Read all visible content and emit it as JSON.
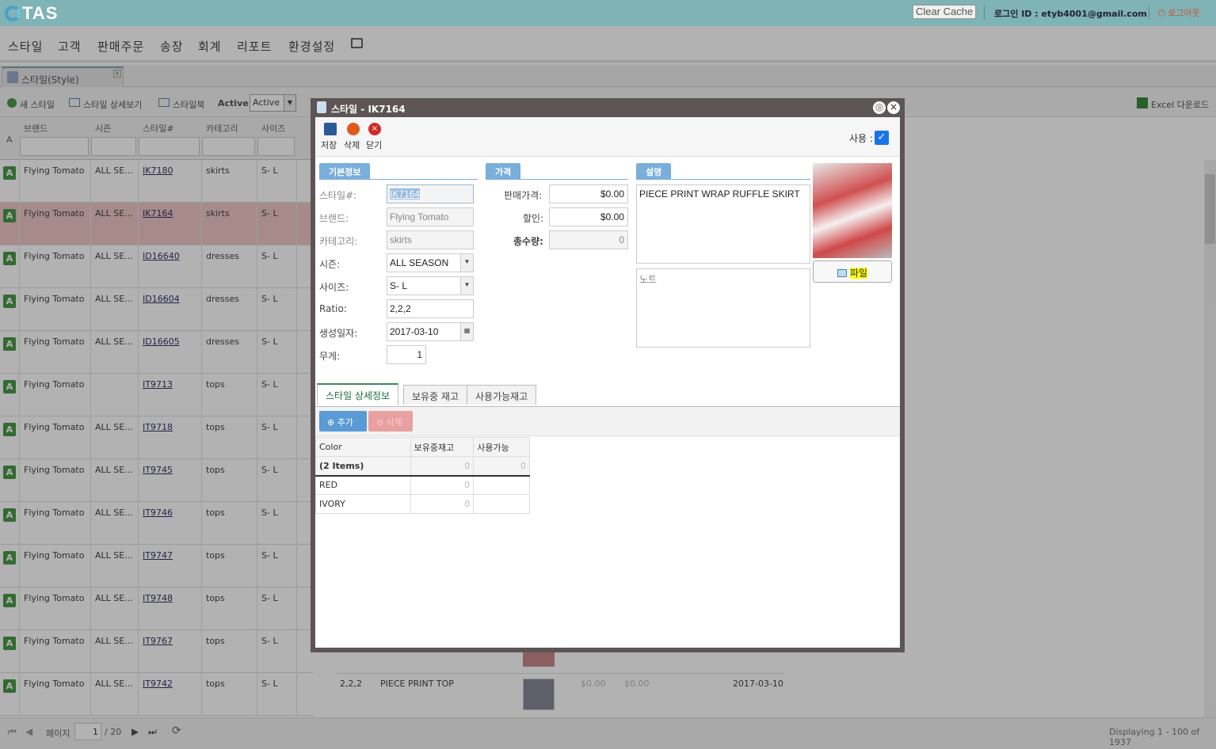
{
  "topbar": {
    "logo": "TAS",
    "clear_cache": "Clear Cache",
    "login_label": "로그인 ID : etyb4001@gmail.com",
    "logout": "로그아웃"
  },
  "menu": {
    "items": [
      "스타일",
      "고객",
      "판매주문",
      "송장",
      "회계",
      "리포트",
      "환경설정"
    ]
  },
  "tab": {
    "label": "스타일(Style)"
  },
  "toolbar": {
    "new_style": "새 스타일",
    "style_detail": "스타일 상세보기",
    "stylebook": "스타일북",
    "active_label": "Active :",
    "active_value": "Active",
    "excel": "Excel 다운로드"
  },
  "grid": {
    "row_header": "A",
    "columns": [
      "브랜드",
      "시즌",
      "스타일#",
      "카테고리",
      "사이즈"
    ],
    "rows": [
      {
        "status": "A",
        "brand": "Flying Tomato",
        "season": "ALL SE...",
        "style": "IK7180",
        "category": "skirts",
        "size": "S- L"
      },
      {
        "status": "A",
        "brand": "Flying Tomato",
        "season": "ALL SE...",
        "style": "IK7164",
        "category": "skirts",
        "size": "S- L"
      },
      {
        "status": "A",
        "brand": "Flying Tomato",
        "season": "ALL SE...",
        "style": "ID16640",
        "category": "dresses",
        "size": "S- L"
      },
      {
        "status": "A",
        "brand": "Flying Tomato",
        "season": "ALL SE...",
        "style": "ID16604",
        "category": "dresses",
        "size": "S- L"
      },
      {
        "status": "A",
        "brand": "Flying Tomato",
        "season": "ALL SE...",
        "style": "ID16605",
        "category": "dresses",
        "size": "S- L"
      },
      {
        "status": "A",
        "brand": "Flying Tomato",
        "season": "",
        "style": "IT9713",
        "category": "tops",
        "size": "S- L"
      },
      {
        "status": "A",
        "brand": "Flying Tomato",
        "season": "ALL SE...",
        "style": "IT9718",
        "category": "tops",
        "size": "S- L"
      },
      {
        "status": "A",
        "brand": "Flying Tomato",
        "season": "ALL SE...",
        "style": "IT9745",
        "category": "tops",
        "size": "S- L"
      },
      {
        "status": "A",
        "brand": "Flying Tomato",
        "season": "ALL SE...",
        "style": "IT9746",
        "category": "tops",
        "size": "S- L"
      },
      {
        "status": "A",
        "brand": "Flying Tomato",
        "season": "ALL SE...",
        "style": "IT9747",
        "category": "tops",
        "size": "S- L"
      },
      {
        "status": "A",
        "brand": "Flying Tomato",
        "season": "ALL SE...",
        "style": "IT9748",
        "category": "tops",
        "size": "S- L"
      },
      {
        "status": "A",
        "brand": "Flying Tomato",
        "season": "ALL SE...",
        "style": "IT9767",
        "category": "tops",
        "size": "S- L"
      },
      {
        "status": "A",
        "brand": "Flying Tomato",
        "season": "ALL SE...",
        "style": "IT9742",
        "category": "tops",
        "size": "S- L"
      }
    ],
    "last_row_extra": {
      "ratio": "2,2,2",
      "desc": "PIECE PRINT TOP",
      "price": "$0.00",
      "discount": "$0.00",
      "date": "2017-03-10"
    }
  },
  "pager": {
    "page_label": "페이지",
    "page_value": "1",
    "page_total": "/ 20",
    "display": "Displaying 1 - 100 of 1937"
  },
  "modal": {
    "title": "스타일 - IK7164",
    "save": "저장",
    "delete": "삭제",
    "close": "닫기",
    "use_label": "사용 :",
    "use_checked": true,
    "basic": {
      "header": "기본정보",
      "style_label": "스타일#:",
      "style_value": "IK7164",
      "brand_label": "브랜드:",
      "brand_value": "Flying Tomato",
      "category_label": "카테고리:",
      "category_value": "skirts",
      "season_label": "시즌:",
      "season_value": "ALL SEASON",
      "size_label": "사이즈:",
      "size_value": "S- L",
      "ratio_label": "Ratio:",
      "ratio_value": "2,2,2",
      "created_label": "생성일자:",
      "created_value": "2017-03-10",
      "weight_label": "무게:",
      "weight_value": "1"
    },
    "price": {
      "header": "가격",
      "sale_label": "판매가격:",
      "sale_value": "$0.00",
      "discount_label": "할인:",
      "discount_value": "$0.00",
      "qty_label": "총수량:",
      "qty_value": "0"
    },
    "desc": {
      "header": "설명",
      "text": "PIECE PRINT WRAP RUFFLE SKIRT",
      "note_placeholder": "노트"
    },
    "file_button": "파일",
    "subtabs": [
      "스타일 상세정보",
      "보유중 재고",
      "사용가능재고"
    ],
    "add_button": "추가",
    "delete_button": "삭제",
    "table": {
      "headers": [
        "Color",
        "보유중재고",
        "사용가능"
      ],
      "group": {
        "label": "(2 Items)",
        "stock": "0",
        "available": "0"
      },
      "rows": [
        {
          "color": "RED",
          "stock": "0",
          "available": ""
        },
        {
          "color": "IVORY",
          "stock": "0",
          "available": ""
        }
      ]
    }
  }
}
